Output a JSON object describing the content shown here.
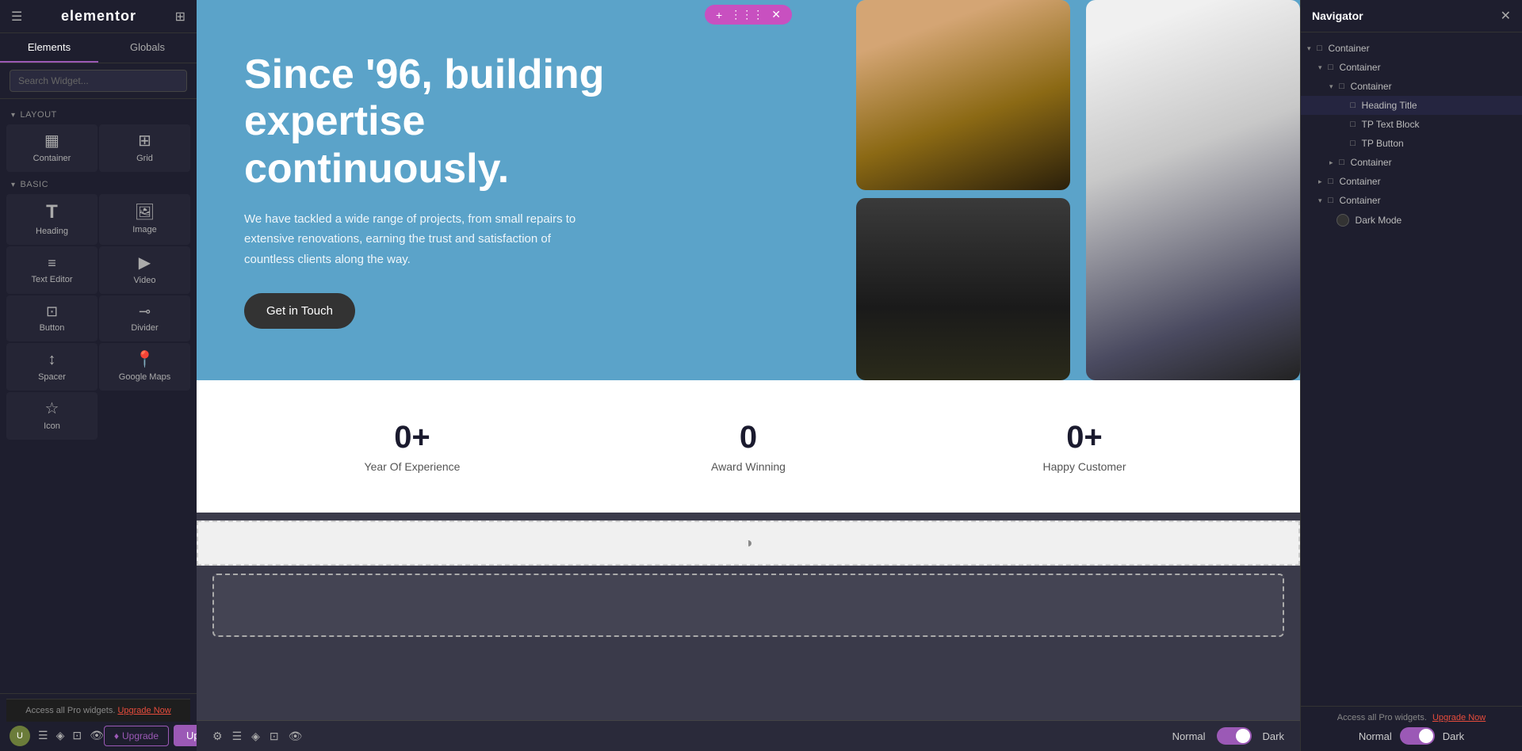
{
  "leftPanel": {
    "logo": "elementor",
    "tabs": [
      {
        "id": "elements",
        "label": "Elements",
        "active": true
      },
      {
        "id": "globals",
        "label": "Globals",
        "active": false
      }
    ],
    "search": {
      "placeholder": "Search Widget..."
    },
    "layout": {
      "title": "Layout",
      "widgets": [
        {
          "id": "container",
          "icon": "▦",
          "label": "Container"
        },
        {
          "id": "grid",
          "icon": "⊞",
          "label": "Grid"
        }
      ]
    },
    "basic": {
      "title": "Basic",
      "widgets": [
        {
          "id": "heading",
          "icon": "T",
          "label": "Heading"
        },
        {
          "id": "image",
          "icon": "🖼",
          "label": "Image"
        },
        {
          "id": "text-editor",
          "icon": "≡",
          "label": "Text Editor"
        },
        {
          "id": "video",
          "icon": "▶",
          "label": "Video"
        },
        {
          "id": "button",
          "icon": "⊡",
          "label": "Button"
        },
        {
          "id": "divider",
          "icon": "⊸",
          "label": "Divider"
        },
        {
          "id": "spacer",
          "icon": "↕",
          "label": "Spacer"
        },
        {
          "id": "google-maps",
          "icon": "📍",
          "label": "Google Maps"
        },
        {
          "id": "icon",
          "icon": "☆",
          "label": "Icon"
        }
      ]
    },
    "upgradeBtn": "Upgrade",
    "proMessage": "Access all Pro widgets.",
    "proLink": "Upgrade Now",
    "updateBtn": "Update"
  },
  "canvas": {
    "toolbarActions": [
      "+",
      "⋮⋮⋮",
      "✕"
    ],
    "hero": {
      "title": "Since '96, building expertise continuously.",
      "description": "We have tackled a wide range of projects, from small repairs to extensive renovations, earning the trust and satisfaction of countless clients along the way.",
      "ctaButton": "Get in Touch"
    },
    "stats": [
      {
        "number": "0+",
        "label": "Year Of Experience"
      },
      {
        "number": "0",
        "label": "Award Winning"
      },
      {
        "number": "0+",
        "label": "Happy Customer"
      }
    ],
    "normalLabel": "Normal",
    "darkLabel": "Dark"
  },
  "rightPanel": {
    "title": "Navigator",
    "closeIcon": "✕",
    "tree": [
      {
        "id": "container-1",
        "label": "Container",
        "indent": 0,
        "hasChevron": true,
        "expanded": true
      },
      {
        "id": "container-2",
        "label": "Container",
        "indent": 1,
        "hasChevron": true,
        "expanded": true
      },
      {
        "id": "container-3",
        "label": "Container",
        "indent": 2,
        "hasChevron": true,
        "expanded": true
      },
      {
        "id": "heading-title",
        "label": "Heading Title",
        "indent": 3,
        "hasChevron": false,
        "expanded": false
      },
      {
        "id": "tp-text-block",
        "label": "TP Text Block",
        "indent": 3,
        "hasChevron": false,
        "expanded": false
      },
      {
        "id": "tp-button",
        "label": "TP Button",
        "indent": 3,
        "hasChevron": false,
        "expanded": false
      },
      {
        "id": "container-4",
        "label": "Container",
        "indent": 2,
        "hasChevron": true,
        "expanded": false
      },
      {
        "id": "container-5",
        "label": "Container",
        "indent": 1,
        "hasChevron": true,
        "expanded": false
      },
      {
        "id": "container-6",
        "label": "Container",
        "indent": 1,
        "hasChevron": true,
        "expanded": true
      },
      {
        "id": "dark-mode",
        "label": "Dark Mode",
        "indent": 2,
        "hasChevron": false,
        "expanded": false,
        "hasToggle": true
      }
    ],
    "upgradeMessage": "Access all Pro widgets.",
    "upgradeLink": "Upgrade Now",
    "modeLabels": {
      "normal": "Normal",
      "dark": "Dark"
    }
  }
}
